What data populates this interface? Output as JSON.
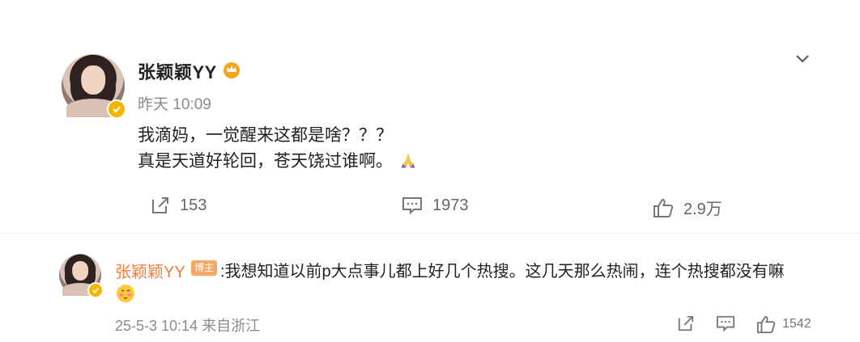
{
  "post": {
    "author": "张颖颖YY",
    "time": "昨天 10:09",
    "lines": [
      "我滴妈，一觉醒来这都是啥？？？",
      "真是天道好轮回，苍天饶过谁啊。"
    ],
    "repost_count": "153",
    "comment_count": "1973",
    "like_count": "2.9万"
  },
  "comment": {
    "author": "张颖颖YY",
    "badge": "博主",
    "text": ":我想知道以前p大点事儿都上好几个热搜。这几天那么热闹，连个热搜都没有嘛",
    "date": "25-5-3 10:14",
    "location": "来自浙江",
    "like_count": "1542"
  },
  "colors": {
    "accent_orange": "#f07d3c",
    "verified_gold": "#f5b400",
    "muted_text": "#8b8b8b"
  }
}
